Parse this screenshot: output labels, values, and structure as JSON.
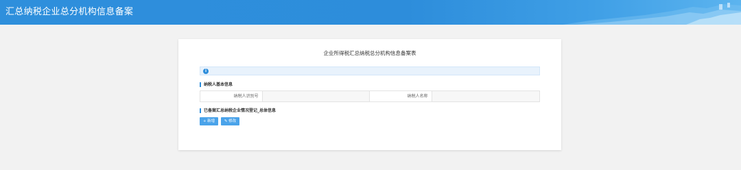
{
  "header": {
    "title": "汇总纳税企业总分机构信息备案"
  },
  "form": {
    "title": "企业所得税汇总纳税总分机构信息备案表",
    "section_basic": "纳税人基本信息",
    "fields": {
      "taxpayer_id_label": "纳税人识别号",
      "taxpayer_id_value": "",
      "taxpayer_name_label": "纳税人名称",
      "taxpayer_name_value": ""
    },
    "section_registered": "已备案汇总纳税企业情况登记_总体信息",
    "buttons": {
      "add": "+ 新增",
      "edit": "✎ 修改"
    }
  },
  "colors": {
    "header_bg": "#2d8ddb",
    "accent": "#2d8ddb",
    "button": "#4aa3ea",
    "page_bg": "#f2f2f2"
  }
}
